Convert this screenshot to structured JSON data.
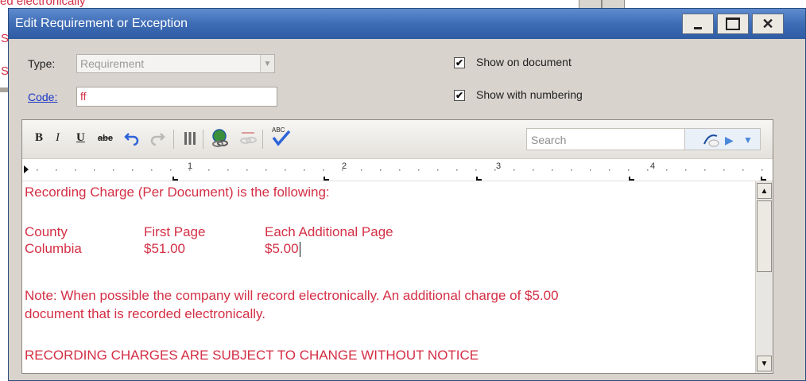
{
  "background": {
    "fragment_top": "ed electronically",
    "fragment_s1": "S",
    "fragment_s2": "S"
  },
  "window": {
    "title": "Edit Requirement or Exception",
    "minimize_glyph": "_",
    "maximize_glyph": "□",
    "close_glyph": "✕"
  },
  "form": {
    "type_label": "Type:",
    "type_value": "Requirement",
    "code_label": "Code:",
    "code_value": "ff",
    "show_on_document_label": "Show on document",
    "show_on_document_checked": "✔",
    "show_with_numbering_label": "Show with numbering",
    "show_with_numbering_checked": "✔"
  },
  "toolbar": {
    "bold": "B",
    "italic": "I",
    "underline": "U",
    "strikethrough": "abe",
    "search_placeholder": "Search",
    "spell_label": "ABC"
  },
  "ruler": {
    "marks": [
      "1",
      "2",
      "3",
      "4"
    ]
  },
  "document": {
    "line1": "Recording Charge (Per Document) is the following:",
    "table_headers": [
      "County",
      "First Page",
      "Each Additional Page"
    ],
    "table_row": [
      "Columbia",
      "$51.00",
      "$5.00"
    ],
    "note_line1": "Note:  When possible the company will record electronically.  An additional charge of $5.00",
    "note_line2": "document that is recorded electronically.",
    "line_last": "RECORDING CHARGES ARE SUBJECT TO CHANGE WITHOUT NOTICE"
  },
  "colors": {
    "document_text": "#d42f45",
    "titlebar": "#3e6cb5",
    "link": "#1a35c9"
  }
}
